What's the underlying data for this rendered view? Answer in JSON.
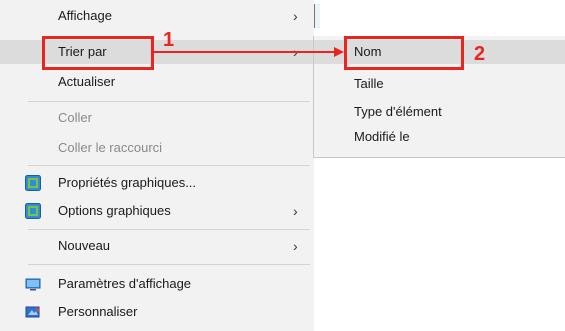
{
  "menu": {
    "items": [
      {
        "label": "Affichage",
        "chevron": "›"
      },
      {
        "label": "Trier par",
        "chevron": "›"
      },
      {
        "label": "Actualiser"
      },
      {
        "label": "Coller"
      },
      {
        "label": "Coller le raccourci"
      },
      {
        "label": "Propriétés graphiques...",
        "icon": "intel-graphics-icon"
      },
      {
        "label": "Options graphiques",
        "icon": "intel-graphics-icon",
        "chevron": "›"
      },
      {
        "label": "Nouveau",
        "chevron": "›"
      },
      {
        "label": "Paramètres d'affichage",
        "icon": "monitor-icon"
      },
      {
        "label": "Personnaliser",
        "icon": "personalize-icon"
      }
    ]
  },
  "submenu": {
    "items": [
      {
        "label": "Nom"
      },
      {
        "label": "Taille"
      },
      {
        "label": "Type d'élément"
      },
      {
        "label": "Modifié le"
      }
    ]
  },
  "annotations": {
    "step1": "1",
    "step2": "2",
    "color": "#e8251f"
  }
}
